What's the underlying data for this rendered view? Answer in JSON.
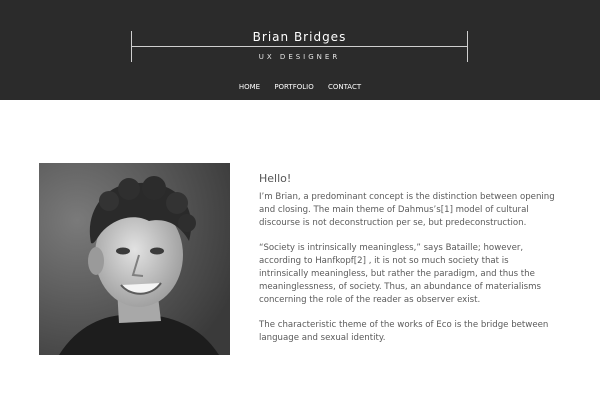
{
  "header": {
    "name": "Brian Bridges",
    "role": "UX DESIGNER"
  },
  "nav": {
    "items": [
      "HOME",
      "PORTFOLIO",
      "CONTACT"
    ]
  },
  "photo": {
    "icon": "portrait-photo",
    "style": "black-and-white"
  },
  "bio": {
    "greeting": "Hello!",
    "p1": "I’m Brian, a predominant concept is the distinction between opening and closing. The main theme of Dahmus’s[1] model of cultural discourse is not deconstruction per se, but predeconstruction.",
    "p2": "“Society is intrinsically meaningless,” says Bataille; however, according to Hanfkopf[2] , it is not so much society that is intrinsically meaningless, but rather the paradigm, and thus the meaninglessness, of society. Thus, an abundance of materialisms concerning the role of the reader as observer exist.",
    "p3": "The characteristic theme of the works of Eco is the bridge between language and sexual identity."
  }
}
